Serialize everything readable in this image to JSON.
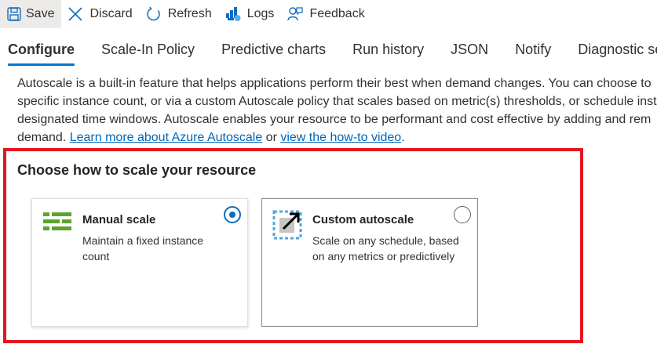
{
  "toolbar": {
    "save_label": "Save",
    "discard_label": "Discard",
    "refresh_label": "Refresh",
    "logs_label": "Logs",
    "feedback_label": "Feedback"
  },
  "tabs": [
    {
      "label": "Configure",
      "active": true
    },
    {
      "label": "Scale-In Policy",
      "active": false
    },
    {
      "label": "Predictive charts",
      "active": false
    },
    {
      "label": "Run history",
      "active": false
    },
    {
      "label": "JSON",
      "active": false
    },
    {
      "label": "Notify",
      "active": false
    },
    {
      "label": "Diagnostic settings",
      "active": false
    }
  ],
  "description": {
    "line1": "Autoscale is a built-in feature that helps applications perform their best when demand changes. You can choose to",
    "line2": "specific instance count, or via a custom Autoscale policy that scales based on metric(s) thresholds, or schedule inst",
    "line3": "designated time windows. Autoscale enables your resource to be performant and cost effective by adding and rem",
    "line4_prefix": "demand. ",
    "link1": "Learn more about Azure Autoscale",
    "line4_mid": " or ",
    "link2": "view the how-to video",
    "line4_suffix": "."
  },
  "scale_section": {
    "title": "Choose how to scale your resource",
    "manual": {
      "title": "Manual scale",
      "text": "Maintain a fixed instance count",
      "selected": true,
      "icon": "manual-scale-icon"
    },
    "custom": {
      "title": "Custom autoscale",
      "text": "Scale on any schedule, based on any metrics or predictively",
      "selected": false,
      "icon": "custom-autoscale-icon"
    }
  },
  "colors": {
    "accent": "#0078d4",
    "link": "#0067b8",
    "highlight": "#e3161d",
    "manual_icon": "#5fa22f"
  }
}
